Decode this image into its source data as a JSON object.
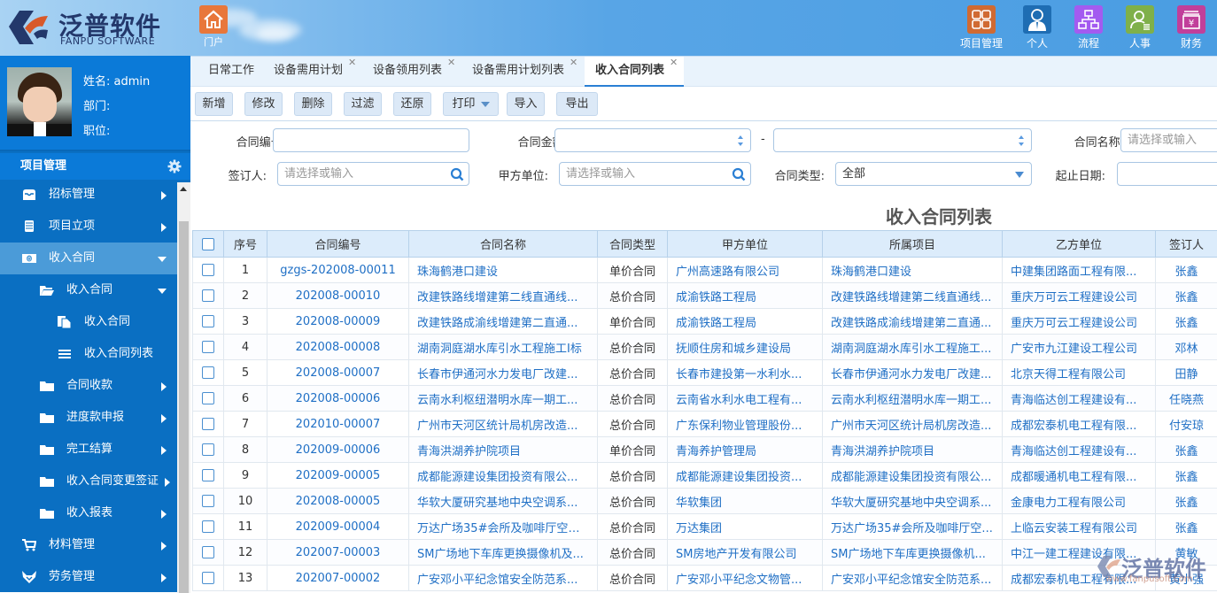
{
  "header": {
    "logo_cn": "泛普软件",
    "logo_en": "FANPU SOFTWARE",
    "portal_label": "门户",
    "nav": [
      {
        "label": "项目管理",
        "icon": "grid-icon",
        "color": "#d06a32"
      },
      {
        "label": "个人",
        "icon": "person-icon",
        "color": "#1e6db3"
      },
      {
        "label": "流程",
        "icon": "flowchart-icon",
        "color": "#a35bf0"
      },
      {
        "label": "人事",
        "icon": "user-list-icon",
        "color": "#7fb04a"
      },
      {
        "label": "财务",
        "icon": "yen-icon",
        "color": "#c13f9a"
      }
    ]
  },
  "user": {
    "name_label": "姓名: admin",
    "dept_label": "部门:",
    "position_label": "职位:"
  },
  "sidebar": {
    "section_title": "项目管理",
    "items": [
      {
        "label": "招标管理",
        "icon": "inbox-icon",
        "level": 1,
        "arrow": "right"
      },
      {
        "label": "项目立项",
        "icon": "document-icon",
        "level": 1,
        "arrow": "right"
      },
      {
        "label": "收入合同",
        "icon": "money-icon",
        "level": 1,
        "arrow": "down",
        "active": true
      },
      {
        "label": "收入合同",
        "icon": "folder-open-icon",
        "level": 2,
        "arrow": "down"
      },
      {
        "label": "收入合同",
        "icon": "file-copy-icon",
        "level": 3
      },
      {
        "label": "收入合同列表",
        "icon": "list-icon",
        "level": 3
      },
      {
        "label": "合同收款",
        "icon": "folder-icon",
        "level": 2,
        "arrow": "right"
      },
      {
        "label": "进度款申报",
        "icon": "folder-icon",
        "level": 2,
        "arrow": "right"
      },
      {
        "label": "完工结算",
        "icon": "folder-icon",
        "level": 2,
        "arrow": "right"
      },
      {
        "label": "收入合同变更签证",
        "icon": "folder-icon",
        "level": 2,
        "arrow": "right"
      },
      {
        "label": "收入报表",
        "icon": "folder-icon",
        "level": 2,
        "arrow": "right"
      },
      {
        "label": "材料管理",
        "icon": "cart-icon",
        "level": 1,
        "arrow": "right"
      },
      {
        "label": "劳务管理",
        "icon": "fox-icon",
        "level": 1,
        "arrow": "right"
      }
    ]
  },
  "tabs": [
    {
      "label": "日常工作",
      "closable": false
    },
    {
      "label": "设备需用计划",
      "closable": true
    },
    {
      "label": "设备领用列表",
      "closable": true
    },
    {
      "label": "设备需用计划列表",
      "closable": true
    },
    {
      "label": "收入合同列表",
      "closable": true,
      "active": true
    }
  ],
  "toolbar": {
    "add": "新增",
    "edit": "修改",
    "delete": "删除",
    "filter": "过滤",
    "reset": "还原",
    "print": "打印",
    "import": "导入",
    "export": "导出"
  },
  "filters": {
    "contract_no_label": "合同编号:",
    "contract_no_value": "",
    "amount_label": "合同金额:",
    "amount_from": "",
    "amount_sep": "-",
    "amount_to": "",
    "contract_name_label": "合同名称:",
    "contract_name_placeholder": "请选择或输入",
    "signer_label": "签订人:",
    "signer_placeholder": "请选择或输入",
    "party_a_label": "甲方单位:",
    "party_a_placeholder": "请选择或输入",
    "type_label": "合同类型:",
    "type_value": "全部",
    "date_label": "起止日期:",
    "date_value": ""
  },
  "grid": {
    "title": "收入合同列表",
    "columns": [
      "序号",
      "合同编号",
      "合同名称",
      "合同类型",
      "甲方单位",
      "所属项目",
      "乙方单位",
      "签订人"
    ],
    "rows": [
      [
        "1",
        "gzgs-202008-00011",
        "珠海鹤港口建设",
        "单价合同",
        "广州高速路有限公司",
        "珠海鹤港口建设",
        "中建集团路面工程有限...",
        "张鑫"
      ],
      [
        "2",
        "202008-00010",
        "改建铁路线增建第二线直通线...",
        "总价合同",
        "成渝铁路工程局",
        "改建铁路线增建第二线直通线...",
        "重庆万可云工程建设公司",
        "张鑫"
      ],
      [
        "3",
        "202008-00009",
        "改建铁路成渝线增建第二直通...",
        "单价合同",
        "成渝铁路工程局",
        "改建铁路成渝线增建第二直通...",
        "重庆万可云工程建设公司",
        "张鑫"
      ],
      [
        "4",
        "202008-00008",
        "湖南洞庭湖水库引水工程施工I标",
        "总价合同",
        "抚顺住房和城乡建设局",
        "湖南洞庭湖水库引水工程施工...",
        "广安市九江建设工程公司",
        "邓林"
      ],
      [
        "5",
        "202008-00007",
        "长春市伊通河水力发电厂改建...",
        "总价合同",
        "长春市建投第一水利水...",
        "长春市伊通河水力发电厂改建...",
        "北京天得工程有限公司",
        "田静"
      ],
      [
        "6",
        "202008-00006",
        "云南水利枢纽潜明水库一期工...",
        "总价合同",
        "云南省水利水电工程有...",
        "云南水利枢纽潜明水库一期工...",
        "青海临达创工程建设有...",
        "任晓燕"
      ],
      [
        "7",
        "202010-00007",
        "广州市天河区统计局机房改造...",
        "总价合同",
        "广东保利物业管理股份...",
        "广州市天河区统计局机房改造...",
        "成都宏泰机电工程有限...",
        "付安琼"
      ],
      [
        "8",
        "202009-00006",
        "青海洪湖养护院项目",
        "单价合同",
        "青海养护管理局",
        "青海洪湖养护院项目",
        "青海临达创工程建设有...",
        "张鑫"
      ],
      [
        "9",
        "202009-00005",
        "成都能源建设集团投资有限公...",
        "总价合同",
        "成都能源建设集团投资...",
        "成都能源建设集团投资有限公...",
        "成都暖通机电工程有限...",
        "张鑫"
      ],
      [
        "10",
        "202008-00005",
        "华软大厦研究基地中央空调系...",
        "总价合同",
        "华软集团",
        "华软大厦研究基地中央空调系...",
        "金康电力工程有限公司",
        "张鑫"
      ],
      [
        "11",
        "202009-00004",
        "万达广场35#会所及咖啡厅空调...",
        "总价合同",
        "万达集团",
        "万达广场35#会所及咖啡厅空...",
        "上临云安装工程有限公司",
        "张鑫"
      ],
      [
        "12",
        "202007-00003",
        "SM广场地下车库更换摄像机及...",
        "总价合同",
        "SM房地产开发有限公司",
        "SM广场地下车库更换摄像机...",
        "中江一建工程建设有限...",
        "黄敏"
      ],
      [
        "13",
        "202007-00002",
        "广安邓小平纪念馆安全防范系...",
        "总价合同",
        "广安邓小平纪念文物管...",
        "广安邓小平纪念馆安全防范系...",
        "成都宏泰机电工程有限...",
        "黄小强"
      ]
    ]
  },
  "watermark": {
    "cn": "泛普软件",
    "url": "www.fanpusoft.com"
  }
}
